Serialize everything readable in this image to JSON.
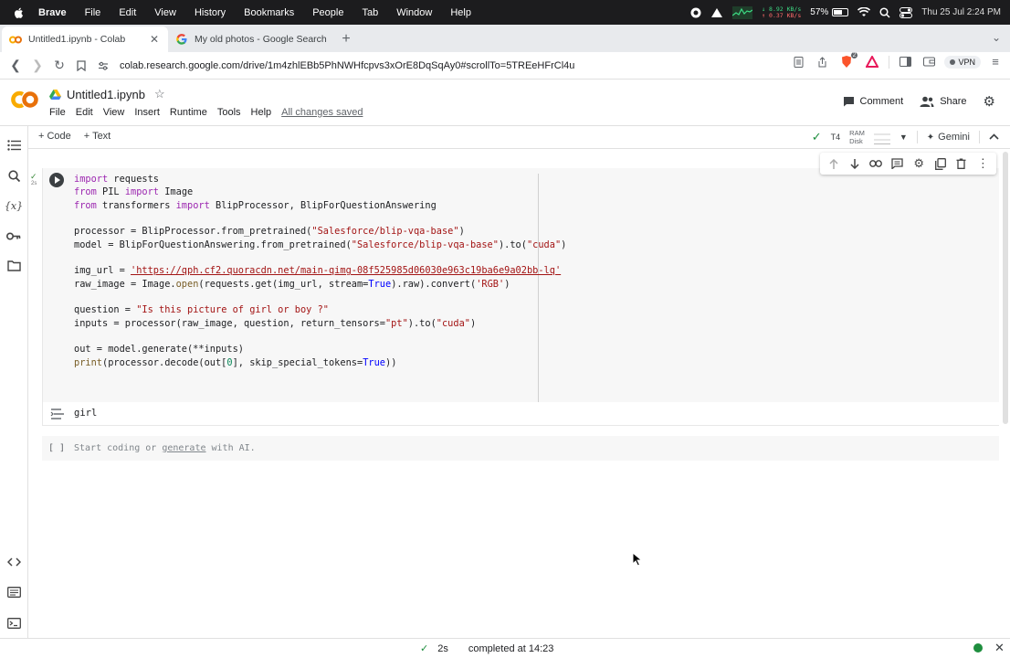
{
  "menubar": {
    "app": "Brave",
    "items": [
      "File",
      "Edit",
      "View",
      "History",
      "Bookmarks",
      "People",
      "Tab",
      "Window",
      "Help"
    ],
    "net_down": "8.92 KB/s",
    "net_up": "0.37 KB/s",
    "battery": "57%",
    "datetime": "Thu 25 Jul  2:24 PM"
  },
  "tabs": [
    {
      "title": "Untitled1.ipynb - Colab",
      "close": "✕"
    },
    {
      "title": "My old photos - Google Search"
    }
  ],
  "new_tab": "+",
  "address": {
    "url": "colab.research.google.com/drive/1m4zhlEBb5PhNWHfcpvs3xOrE8DqSqAy0#scrollTo=5TREeHFrCl4u",
    "shield_count": "2",
    "vpn": "VPN"
  },
  "notebook": {
    "title": "Untitled1.ipynb",
    "menu": [
      "File",
      "Edit",
      "View",
      "Insert",
      "Runtime",
      "Tools",
      "Help"
    ],
    "saved": "All changes saved",
    "comment": "Comment",
    "share": "Share"
  },
  "toolbar": {
    "code": "+ Code",
    "text": "+ Text",
    "runtime": "T4",
    "ram": "RAM",
    "disk": "Disk",
    "gemini": "Gemini"
  },
  "cell": {
    "exec_time": "2s",
    "lines": [
      [
        [
          "kw",
          "import"
        ],
        [
          "",
          "requests"
        ]
      ],
      [
        [
          "kw",
          "from"
        ],
        [
          "",
          "PIL "
        ],
        [
          "kw",
          "import"
        ],
        [
          "",
          " Image"
        ]
      ],
      [
        [
          "kw",
          "from"
        ],
        [
          "",
          " transformers "
        ],
        [
          "kw",
          "import"
        ],
        [
          "",
          " BlipProcessor, BlipForQuestionAnswering"
        ]
      ],
      [],
      [
        [
          "",
          "processor = BlipProcessor.from_pretrained("
        ],
        [
          "str",
          "\"Salesforce/blip-vqa-base\""
        ],
        [
          "",
          ")"
        ]
      ],
      [
        [
          "",
          "model = BlipForQuestionAnswering.from_pretrained("
        ],
        [
          "str",
          "\"Salesforce/blip-vqa-base\""
        ],
        [
          "",
          ").to("
        ],
        [
          "str",
          "\"cuda\""
        ],
        [
          "",
          ")"
        ]
      ],
      [],
      [
        [
          "",
          "img_url = "
        ],
        [
          "url",
          "'https://qph.cf2.quoracdn.net/main-qimg-08f525985d06030e963c19ba6e9a02bb-lq'"
        ]
      ],
      [
        [
          "",
          "raw_image = Image."
        ],
        [
          "fn",
          "open"
        ],
        [
          "",
          "(requests.get(img_url, stream="
        ],
        [
          "cst",
          "True"
        ],
        [
          "",
          ").raw).convert("
        ],
        [
          "str",
          "'RGB'"
        ],
        [
          "",
          ")"
        ]
      ],
      [],
      [
        [
          "",
          "question = "
        ],
        [
          "str",
          "\"Is this picture of girl or boy ?\""
        ]
      ],
      [
        [
          "",
          "inputs = processor(raw_image, question, return_tensors="
        ],
        [
          "str",
          "\"pt\""
        ],
        [
          "",
          ").to("
        ],
        [
          "str",
          "\"cuda\""
        ],
        [
          "",
          ")"
        ]
      ],
      [],
      [
        [
          "",
          "out = model.generate(**inputs)"
        ]
      ],
      [
        [
          "fn",
          "print"
        ],
        [
          "",
          "(processor.decode(out["
        ],
        [
          "num",
          "0"
        ],
        [
          "",
          "], skip_special_tokens="
        ],
        [
          "cst",
          "True"
        ],
        [
          "",
          "))"
        ]
      ]
    ],
    "output": "girl"
  },
  "empty_cell": {
    "bracket": "[ ]",
    "placeholder_pre": "Start coding or ",
    "placeholder_link": "generate",
    "placeholder_post": " with AI."
  },
  "status": {
    "time": "2s",
    "completed": "completed at 14:23"
  },
  "colors": {
    "accent_orange": "#f9ab00",
    "status_green": "#1e8e3e",
    "keyword": "#9c27b0",
    "string": "#a31515"
  }
}
